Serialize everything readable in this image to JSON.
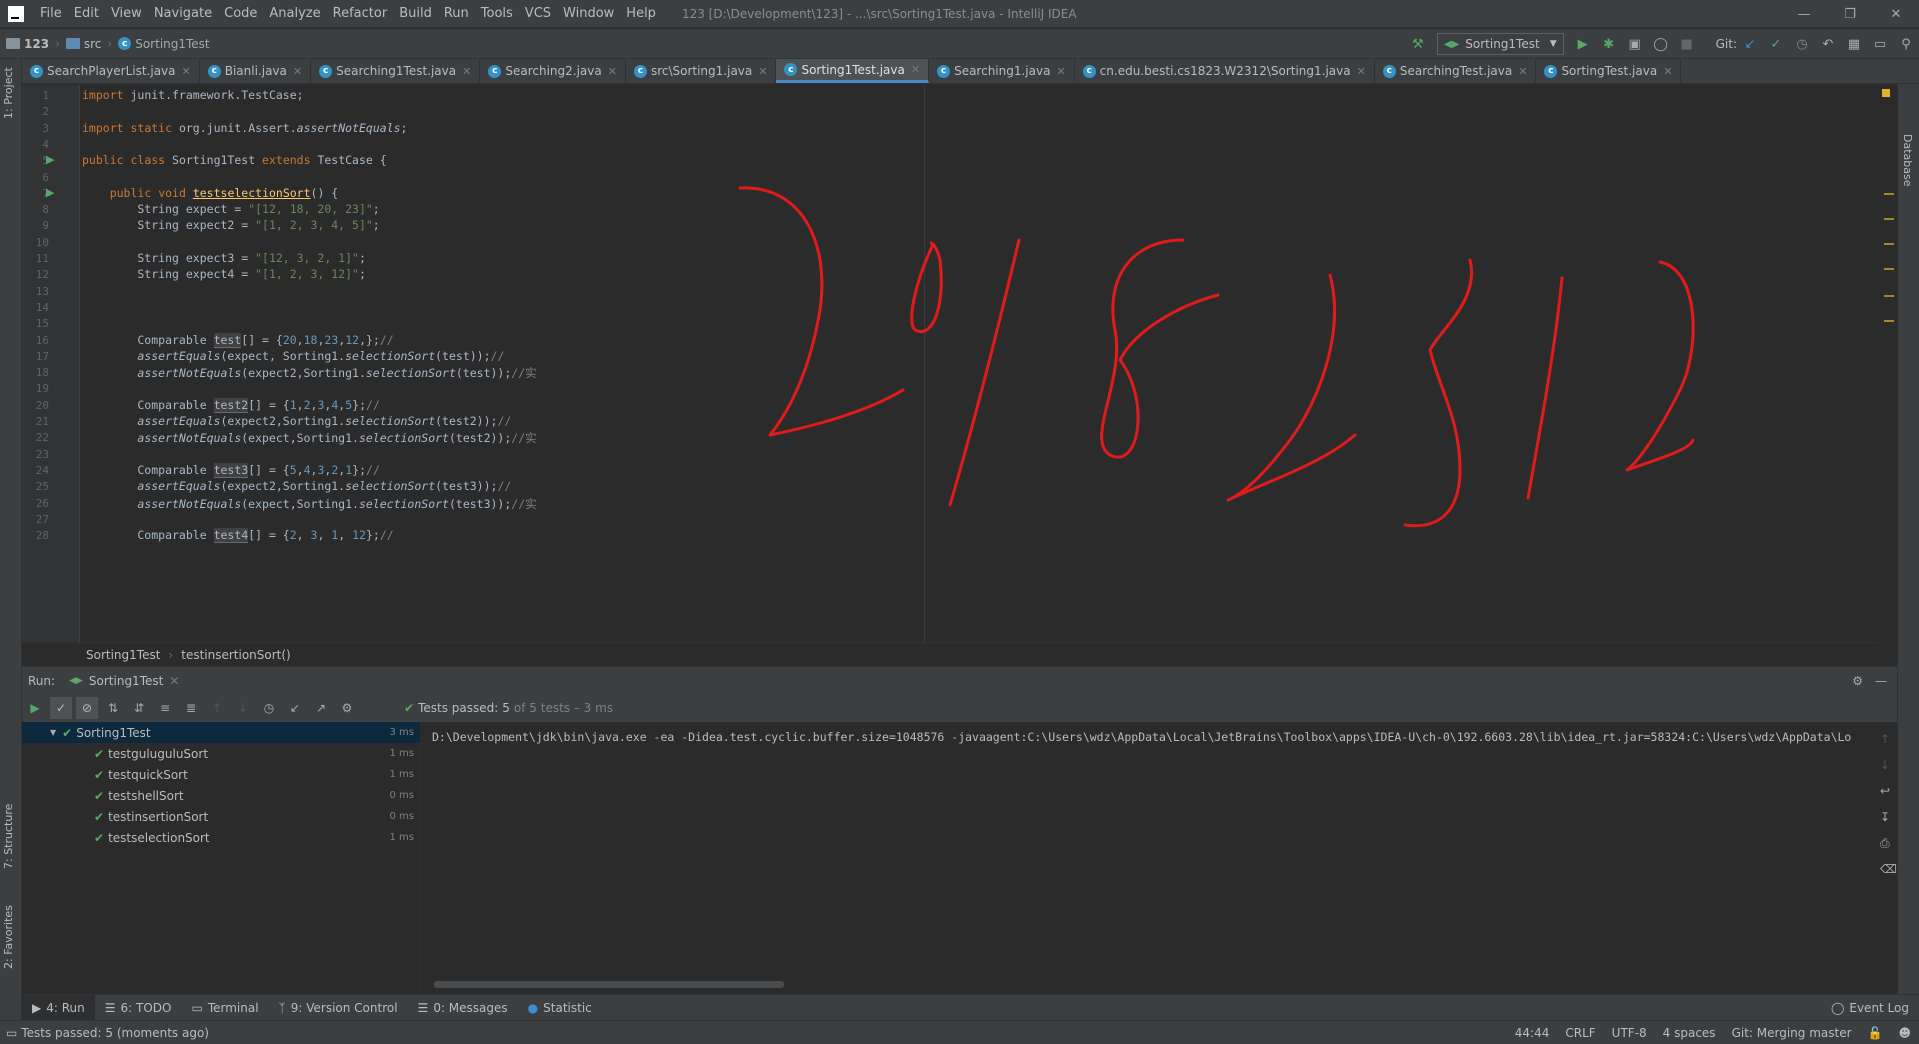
{
  "window": {
    "title": "123 [D:\\Development\\123] - ...\\src\\Sorting1Test.java - IntelliJ IDEA",
    "menus": [
      "File",
      "Edit",
      "View",
      "Navigate",
      "Code",
      "Analyze",
      "Refactor",
      "Build",
      "Run",
      "Tools",
      "VCS",
      "Window",
      "Help"
    ]
  },
  "navbar": {
    "project": "123",
    "folder": "src",
    "file": "Sorting1Test",
    "run_config": "Sorting1Test",
    "git_label": "Git:"
  },
  "tabs": [
    {
      "label": "SearchPlayerList.java",
      "active": false
    },
    {
      "label": "Bianli.java",
      "active": false
    },
    {
      "label": "Searching1Test.java",
      "active": false
    },
    {
      "label": "Searching2.java",
      "active": false
    },
    {
      "label": "src\\Sorting1.java",
      "active": false
    },
    {
      "label": "Sorting1Test.java",
      "active": true
    },
    {
      "label": "Searching1.java",
      "active": false
    },
    {
      "label": "cn.edu.besti.cs1823.W2312\\Sorting1.java",
      "active": false
    },
    {
      "label": "SearchingTest.java",
      "active": false
    },
    {
      "label": "SortingTest.java",
      "active": false
    }
  ],
  "side_tools": {
    "project": "1: Project",
    "structure": "7: Structure",
    "favorites": "2: Favorites",
    "database": "Database"
  },
  "code_lines": [
    "import junit.framework.TestCase;",
    "",
    "import static org.junit.Assert.assertNotEquals;",
    "",
    "public class Sorting1Test extends TestCase {",
    "",
    "    public void testselectionSort() {",
    "        String expect = \"[12, 18, 20, 23]\";",
    "        String expect2 = \"[1, 2, 3, 4, 5]\";",
    "",
    "        String expect3 = \"[12, 3, 2, 1]\";",
    "        String expect4 = \"[1, 2, 3, 12]\";",
    "",
    "",
    "",
    "        Comparable test[] = {20,18,23,12,};//",
    "        assertEquals(expect, Sorting1.selectionSort(test));//",
    "        assertNotEquals(expect2,Sorting1.selectionSort(test));//实",
    "",
    "        Comparable test2[] = {1,2,3,4,5};//",
    "        assertEquals(expect2,Sorting1.selectionSort(test2));//",
    "        assertNotEquals(expect,Sorting1.selectionSort(test2));//实",
    "",
    "        Comparable test3[] = {5,4,3,2,1};//",
    "        assertEquals(expect2,Sorting1.selectionSort(test3));//",
    "        assertNotEquals(expect,Sorting1.selectionSort(test3));//实",
    "",
    "        Comparable test4[] = {2, 3, 1, 12};//"
  ],
  "code_breadcrumb": {
    "cls": "Sorting1Test",
    "method": "testinsertionSort()"
  },
  "run_panel": {
    "label": "Run:",
    "tab": "Sorting1Test",
    "status": "Tests passed:",
    "passed_count": "5",
    "of_text": "of 5 tests – 3 ms",
    "tree": [
      {
        "name": "Sorting1Test",
        "time": "3 ms",
        "root": true
      },
      {
        "name": "testguluguluSort",
        "time": "1 ms"
      },
      {
        "name": "testquickSort",
        "time": "1 ms"
      },
      {
        "name": "testshellSort",
        "time": "0 ms"
      },
      {
        "name": "testinsertionSort",
        "time": "0 ms"
      },
      {
        "name": "testselectionSort",
        "time": "1 ms"
      }
    ],
    "console_line": "D:\\Development\\jdk\\bin\\java.exe -ea -Didea.test.cyclic.buffer.size=1048576 -javaagent:C:\\Users\\wdz\\AppData\\Local\\JetBrains\\Toolbox\\apps\\IDEA-U\\ch-0\\192.6603.28\\lib\\idea_rt.jar=58324:C:\\Users\\wdz\\AppData\\Lo"
  },
  "bottom_tabs": [
    "4: Run",
    "6: TODO",
    "Terminal",
    "9: Version Control",
    "0: Messages",
    "Statistic"
  ],
  "event_log": "Event Log",
  "status_bar": {
    "message": "Tests passed: 5 (moments ago)",
    "position": "44:44",
    "line_sep": "CRLF",
    "encoding": "UTF-8",
    "indent": "4 spaces",
    "git": "Git: Merging master"
  },
  "handwriting": {
    "text": "20182312",
    "color": "#e01b1b"
  }
}
